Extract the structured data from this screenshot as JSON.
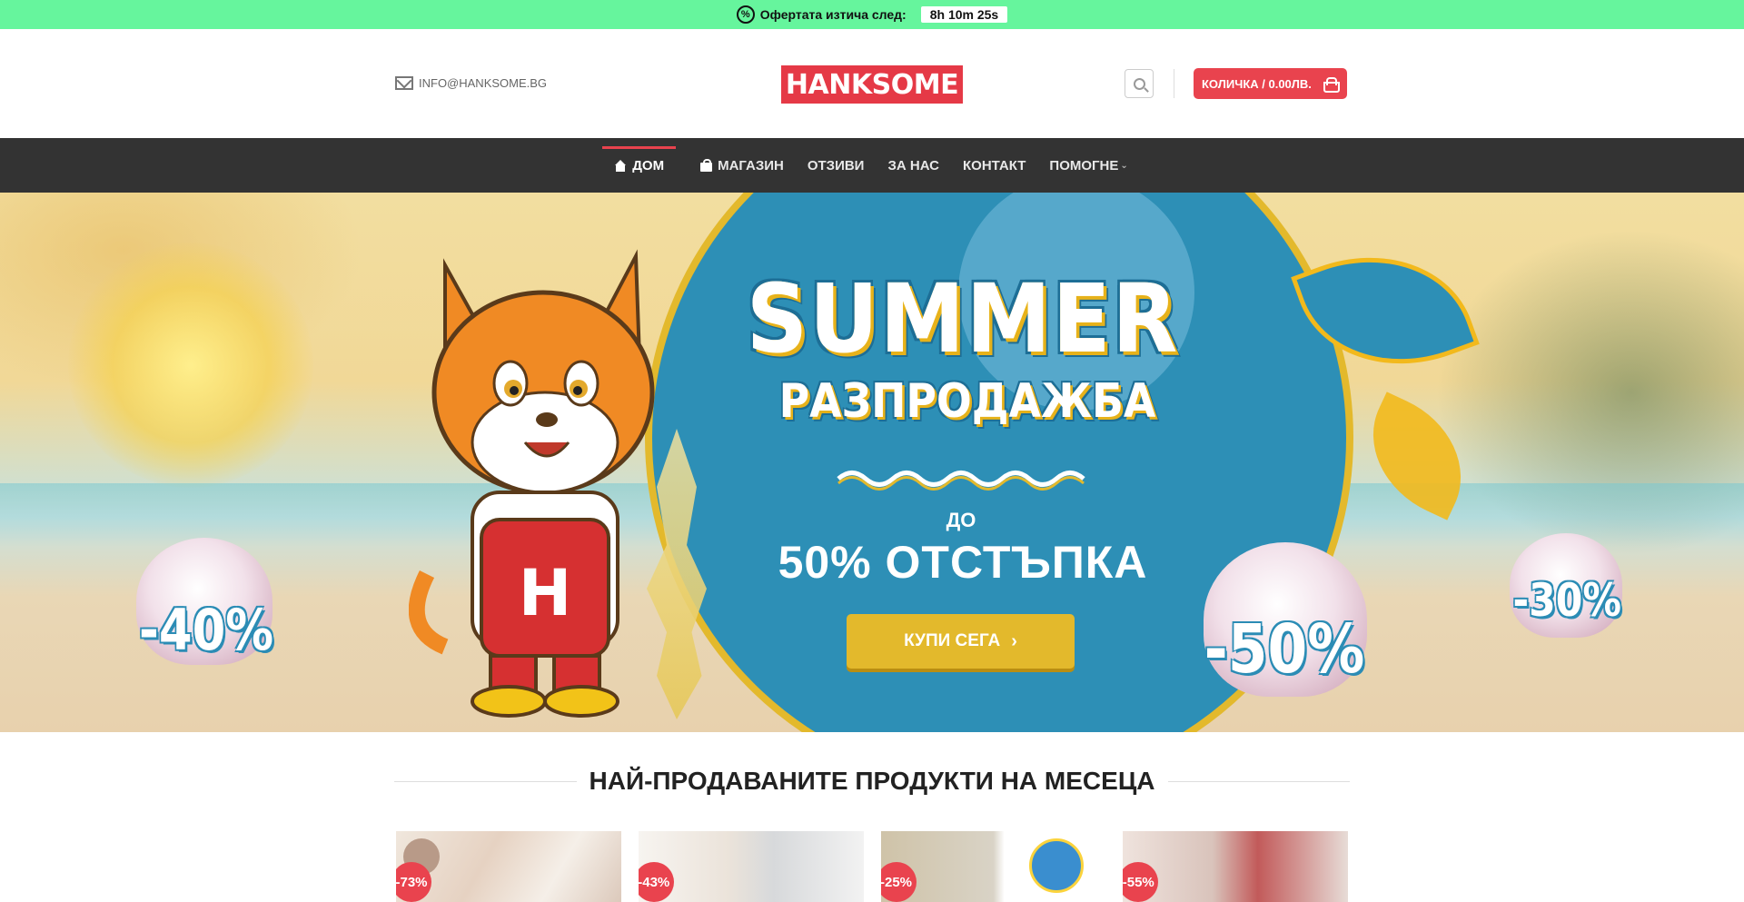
{
  "promo": {
    "icon": "percent-badge-icon",
    "label": "Офертата изтича след:",
    "timer": "8h 10m 25s"
  },
  "header": {
    "email": "INFO@HANKSOME.BG",
    "logo_text": "HANKSOME",
    "cart_label": "КОЛИЧКА / 0.00ЛВ."
  },
  "nav": {
    "items": [
      {
        "label": "ДОМ",
        "icon": "home-icon",
        "active": true
      },
      {
        "label": "МАГАЗИН",
        "icon": "shopping-bag-icon"
      },
      {
        "label": "ОТЗИВИ"
      },
      {
        "label": "ЗА НАС"
      },
      {
        "label": "КОНТАКТ"
      },
      {
        "label": "ПОМОГНЕ",
        "icon": "chevron-down-icon"
      }
    ]
  },
  "hero": {
    "title": "SUMMER",
    "subtitle": "РАЗПРОДАЖБА",
    "upto": "ДО",
    "discount": "50% ОТСТЪПКА",
    "cta_label": "КУПИ СЕГА",
    "shell_badges": [
      "-40%",
      "-50%",
      "-30%"
    ],
    "mascot_letter": "H"
  },
  "bestsellers": {
    "title": "НАЙ-ПРОДАВАНИТЕ ПРОДУКТИ НА МЕСЕЦА",
    "products": [
      {
        "discount": "-73%"
      },
      {
        "discount": "-43%"
      },
      {
        "discount": "-25%"
      },
      {
        "discount": "-55%"
      }
    ]
  },
  "colors": {
    "promo_bar": "#66f59d",
    "brand_red": "#e53946",
    "nav_bg": "#333333",
    "cta_yellow": "#e3b92c",
    "hero_blue": "#2d8fb6"
  }
}
